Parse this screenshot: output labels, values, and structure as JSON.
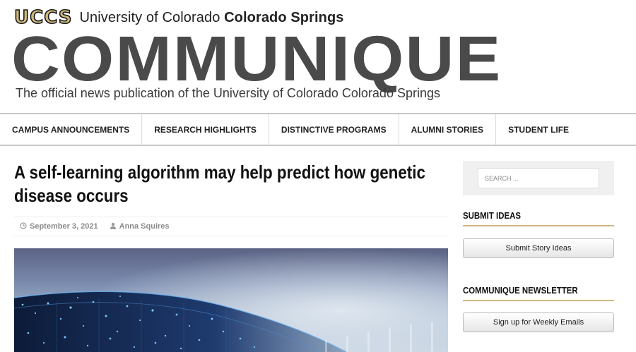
{
  "header": {
    "logo_text": "UCCS",
    "university_prefix": "University of Colorado",
    "university_bold": "Colorado Springs",
    "masthead": "COMMUNIQUE",
    "tagline": "The official news publication of the University of Colorado Colorado Springs"
  },
  "nav": {
    "items": [
      {
        "label": "CAMPUS ANNOUNCEMENTS"
      },
      {
        "label": "RESEARCH HIGHLIGHTS"
      },
      {
        "label": "DISTINCTIVE PROGRAMS"
      },
      {
        "label": "ALUMNI STORIES"
      },
      {
        "label": "STUDENT LIFE"
      }
    ]
  },
  "article": {
    "title": "A self-learning algorithm may help predict how genetic disease occurs",
    "date": "September 3, 2021",
    "author": "Anna Squires",
    "date_icon": "clock-icon",
    "author_icon": "user-icon"
  },
  "sidebar": {
    "search_placeholder": "SEARCH ...",
    "submit_ideas_title": "SUBMIT IDEAS",
    "submit_ideas_button": "Submit Story Ideas",
    "newsletter_title": "COMMUNIQUE NEWSLETTER",
    "newsletter_button": "Sign up for Weekly Emails"
  },
  "colors": {
    "gold_accent": "#cfb87c",
    "masthead_gray": "#4a4a4a"
  }
}
